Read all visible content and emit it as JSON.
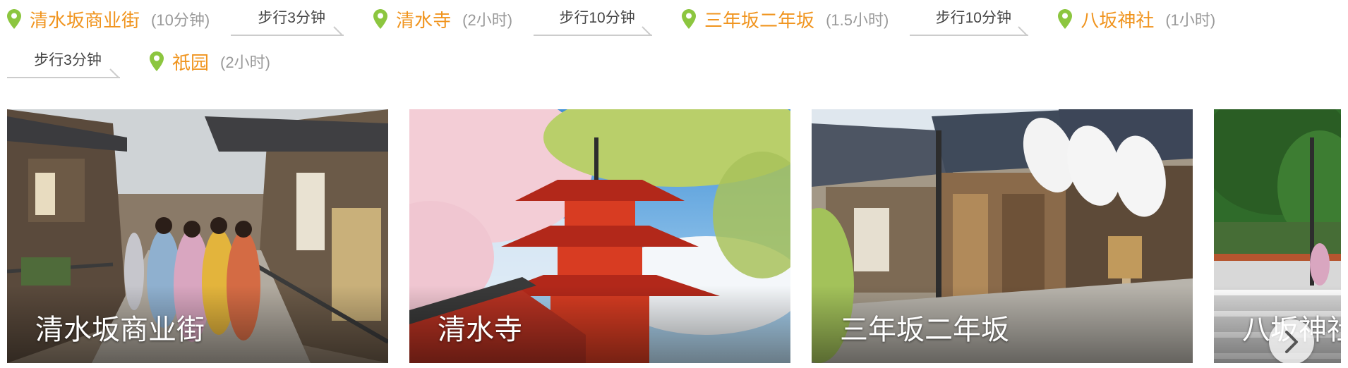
{
  "route": {
    "stops": [
      {
        "name": "清水坂商业街",
        "duration": "(10分钟)"
      },
      {
        "name": "清水寺",
        "duration": "(2小时)"
      },
      {
        "name": "三年坂二年坂",
        "duration": "(1.5小时)"
      },
      {
        "name": "八坂神社",
        "duration": "(1小时)"
      },
      {
        "name": "祇园",
        "duration": "(2小时)"
      }
    ],
    "walks": [
      "步行3分钟",
      "步行10分钟",
      "步行10分钟",
      "步行3分钟"
    ]
  },
  "gallery": {
    "cards": [
      {
        "title": "清水坂商业街"
      },
      {
        "title": "清水寺"
      },
      {
        "title": "三年坂二年坂"
      },
      {
        "title": "八坂神社"
      }
    ],
    "next_icon": "chevron-right-icon"
  },
  "colors": {
    "stop_name": "#f0941e",
    "duration": "#999999",
    "pin": "#8cc63f"
  }
}
